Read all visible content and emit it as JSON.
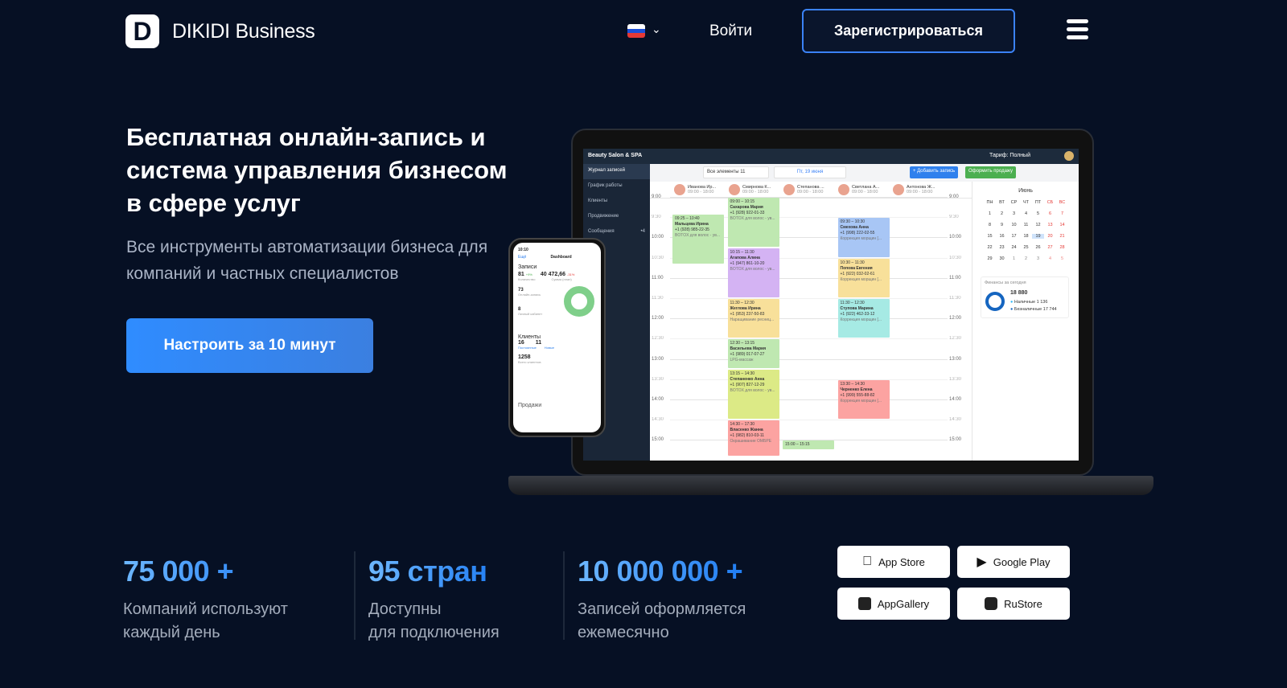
{
  "header": {
    "logo_letter": "D",
    "brand": "DIKIDI Business",
    "language_flag": "ru",
    "login": "Войти",
    "register": "Зарегистрироваться"
  },
  "hero": {
    "title": "Бесплатная онлайн-запись и система управления бизнесом в сфере услуг",
    "subtitle": "Все инструменты автоматизации бизнеса для компаний и частных специалистов",
    "cta": "Настроить за 10 минут"
  },
  "stats": [
    {
      "value": "75 000 +",
      "label1": "Компаний используют",
      "label2": "каждый день"
    },
    {
      "value": "95 стран",
      "label1": "Доступны",
      "label2": "для подключения"
    },
    {
      "value": "10 000 000 +",
      "label1": "Записей оформляется",
      "label2": "ежемесячно"
    }
  ],
  "stores": [
    {
      "label": "App Store",
      "icon": "apple-icon"
    },
    {
      "label": "Google Play",
      "icon": "google-play-icon"
    },
    {
      "label": "AppGallery",
      "icon": "huawei-icon"
    },
    {
      "label": "RuStore",
      "icon": "rustore-icon"
    }
  ],
  "app": {
    "salon": "Beauty Salon & SPA",
    "tariff": "Тариф: Полный",
    "sidebar": [
      "Журнал записей",
      "График работы",
      "Клиенты",
      "Продвижение",
      "Сообщения"
    ],
    "messages_badge": "4",
    "toolbar": {
      "filter": "Все элементы 11",
      "date": "Пт, 19 июня",
      "add": "+ Добавить запись",
      "sale": "Оформить продажу"
    },
    "staff": [
      {
        "name": "Иванова Ир...",
        "hours": "09:00 - 18:00"
      },
      {
        "name": "Смирнова К...",
        "hours": "09:00 - 18:00"
      },
      {
        "name": "Степанова ...",
        "hours": "09:00 - 18:00"
      },
      {
        "name": "Светлана А...",
        "hours": "09:00 - 18:00"
      },
      {
        "name": "Антонова Ж...",
        "hours": "09:00 - 18:00"
      }
    ],
    "times": [
      "9:00",
      "9:30",
      "10:00",
      "10:30",
      "11:00",
      "11:30",
      "12:00",
      "12:30",
      "13:00",
      "13:30",
      "14:00",
      "14:30",
      "15:00"
    ],
    "appointments": [
      {
        "col": 0,
        "start": 9.4167,
        "end": 10.6667,
        "time": "09:25 – 10:40",
        "name": "Мальцева Ирина",
        "phone": "+1 (928) 985-22-35",
        "service": "BOTOX для волос - ув...",
        "color": "#bfe8b1"
      },
      {
        "col": 1,
        "start": 9,
        "end": 10.25,
        "time": "09:00 – 10:15",
        "name": "Сахарова Мария",
        "phone": "+1 (928) 922-01-33",
        "service": "BOTOX для волос - ув...",
        "color": "#bfe8b1"
      },
      {
        "col": 1,
        "start": 10.25,
        "end": 11.5,
        "time": "10:15 – 11:30",
        "name": "Агапова Алина",
        "phone": "+1 (947) 861-10-20",
        "service": "BOTOX для волос - ув...",
        "color": "#d4b3f3"
      },
      {
        "col": 1,
        "start": 11.5,
        "end": 12.5,
        "time": "11:30 – 12:30",
        "name": "Жеглова Ирина",
        "phone": "+1 (953) 237-50-83",
        "service": "Наращивание ресниц...",
        "color": "#f8e09a"
      },
      {
        "col": 1,
        "start": 12.5,
        "end": 13.25,
        "time": "12:30 – 13:15",
        "name": "Васильева Мария",
        "phone": "+1 (989) 017-07-27",
        "service": "LPG-массаж",
        "color": "#bfe8b1"
      },
      {
        "col": 1,
        "start": 13.25,
        "end": 14.5,
        "time": "13:15 – 14:30",
        "name": "Степаненко Анна",
        "phone": "+1 (907) 827-12-29",
        "service": "BOTOX для волос - ув...",
        "color": "#dcea86"
      },
      {
        "col": 1,
        "start": 14.5,
        "end": 15.4,
        "time": "14:30 – 17:30",
        "name": "Власенко Жанна",
        "phone": "+1 (982) 810-03-11",
        "service": "Окрашивание ОМБРЕ",
        "color": "#fca3a1"
      },
      {
        "col": 2,
        "start": 15,
        "end": 15.25,
        "time": "15:00 – 15:15",
        "name": "",
        "phone": "",
        "service": "",
        "color": "#bfe8b1"
      },
      {
        "col": 3,
        "start": 9.5,
        "end": 10.5,
        "time": "09:30 – 10:30",
        "name": "Смехова Анна",
        "phone": "+1 (998) 222-02-55",
        "service": "Коррекция морщин [...",
        "color": "#a8c6f5"
      },
      {
        "col": 3,
        "start": 10.5,
        "end": 11.5,
        "time": "10:30 – 11:30",
        "name": "Попова Евгения",
        "phone": "+1 (922) 032-02-61",
        "service": "Коррекция морщин [...",
        "color": "#f8e09a"
      },
      {
        "col": 3,
        "start": 11.5,
        "end": 12.5,
        "time": "11:30 – 12:30",
        "name": "Ступова Марина",
        "phone": "+1 (922) 462-33-12",
        "service": "Коррекция морщин [...",
        "color": "#a6eae4"
      },
      {
        "col": 3,
        "start": 13.5,
        "end": 14.5,
        "time": "13:30 – 14:30",
        "name": "Черненко Елена",
        "phone": "+1 (999) 555-88-82",
        "service": "Коррекция морщин [...",
        "color": "#fca3a1"
      }
    ],
    "calendar": {
      "month": "Июнь",
      "weekdays": [
        "ПН",
        "ВТ",
        "СР",
        "ЧТ",
        "ПТ",
        "СБ",
        "ВС"
      ],
      "days": [
        "1",
        "2",
        "3",
        "4",
        "5",
        "6",
        "7",
        "8",
        "9",
        "10",
        "11",
        "12",
        "13",
        "14",
        "15",
        "16",
        "17",
        "18",
        "19",
        "20",
        "21",
        "22",
        "23",
        "24",
        "25",
        "26",
        "27",
        "28",
        "29",
        "30",
        "1",
        "2",
        "3",
        "4",
        "5"
      ],
      "selected": "19"
    },
    "finance": {
      "title": "Финансы за сегодня",
      "total": "18 880",
      "cash_label": "Наличные",
      "cash": "1 136",
      "card_label": "Безналичные",
      "card": "17 744"
    }
  },
  "phone": {
    "time": "10:10",
    "back": "Ещё",
    "title": "Dashboard",
    "records_title": "Записи",
    "count": "81",
    "count_change": "+9%",
    "count_label": "Количество",
    "sum": "40 472,66",
    "sum_change": "-31%",
    "sum_label": "Сумма (план)",
    "online": "73",
    "online_label": "Онлайн-запись",
    "cabinet": "8",
    "cabinet_label": "Личный кабинет",
    "clients_title": "Клиенты",
    "regular": "16",
    "regular_label": "Постоянные",
    "new": "11",
    "new_label": "Новые",
    "total": "1258",
    "total_label": "Всего клиентов",
    "sales_title": "Продажи"
  },
  "colors": {
    "background": "#061024",
    "accent": "#2f8cff",
    "register_border": "#3b82f6"
  }
}
